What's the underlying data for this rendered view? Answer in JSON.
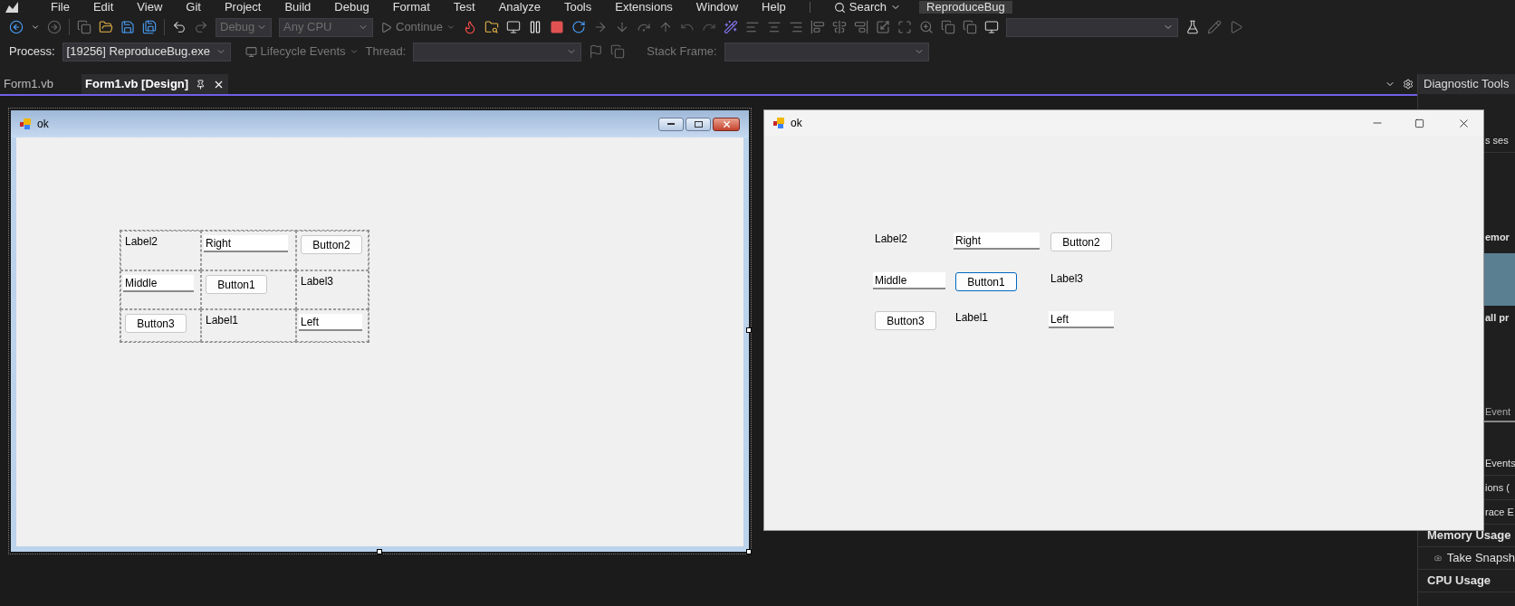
{
  "menu": [
    "File",
    "Edit",
    "View",
    "Git",
    "Project",
    "Build",
    "Debug",
    "Format",
    "Test",
    "Analyze",
    "Tools",
    "Extensions",
    "Window",
    "Help"
  ],
  "search": {
    "label": "Search"
  },
  "solution_name": "ReproduceBug",
  "toolbar": {
    "configuration": "Debug",
    "platform": "Any CPU",
    "continue": "Continue"
  },
  "debug_location": {
    "process_label": "Process:",
    "process": "[19256] ReproduceBug.exe",
    "lifecycle": "Lifecycle Events",
    "thread_label": "Thread:",
    "stack_frame_label": "Stack Frame:"
  },
  "tabs": [
    {
      "label": "Form1.vb",
      "selected": false
    },
    {
      "label": "Form1.vb [Design]",
      "selected": true
    }
  ],
  "designer_form": {
    "title": "ok",
    "cells": [
      {
        "kind": "label",
        "text": "Label2"
      },
      {
        "kind": "textbox",
        "text": "Right"
      },
      {
        "kind": "button",
        "text": "Button2"
      },
      {
        "kind": "textbox",
        "text": "Middle"
      },
      {
        "kind": "button",
        "text": "Button1"
      },
      {
        "kind": "label",
        "text": "Label3"
      },
      {
        "kind": "button",
        "text": "Button3"
      },
      {
        "kind": "label",
        "text": "Label1"
      },
      {
        "kind": "textbox",
        "text": "Left"
      }
    ]
  },
  "running_form": {
    "title": "ok",
    "cells": [
      {
        "kind": "label",
        "text": "Label2"
      },
      {
        "kind": "textbox",
        "text": "Right"
      },
      {
        "kind": "button",
        "text": "Button2",
        "focused": false
      },
      {
        "kind": "textbox",
        "text": "Middle"
      },
      {
        "kind": "button",
        "text": "Button1",
        "focused": true
      },
      {
        "kind": "label",
        "text": "Label3"
      },
      {
        "kind": "button",
        "text": "Button3",
        "focused": false
      },
      {
        "kind": "label",
        "text": "Label1"
      },
      {
        "kind": "textbox",
        "text": "Left"
      }
    ]
  },
  "diagnostic_tools": {
    "title": "Diagnostic Tools",
    "rows": [
      {
        "kind": "text",
        "text": "s ses"
      },
      {
        "kind": "heading",
        "text": "emor"
      },
      {
        "kind": "chart"
      },
      {
        "kind": "heading",
        "text": "all pr"
      },
      {
        "kind": "tab",
        "text": "Event"
      },
      {
        "kind": "text",
        "text": "Events"
      },
      {
        "kind": "text",
        "text": "ions ("
      },
      {
        "kind": "text",
        "text": "race E"
      },
      {
        "kind": "section",
        "text": "Memory Usage"
      },
      {
        "kind": "snapshot",
        "text": "Take Snapsh"
      },
      {
        "kind": "section",
        "text": "CPU Usage"
      }
    ]
  }
}
